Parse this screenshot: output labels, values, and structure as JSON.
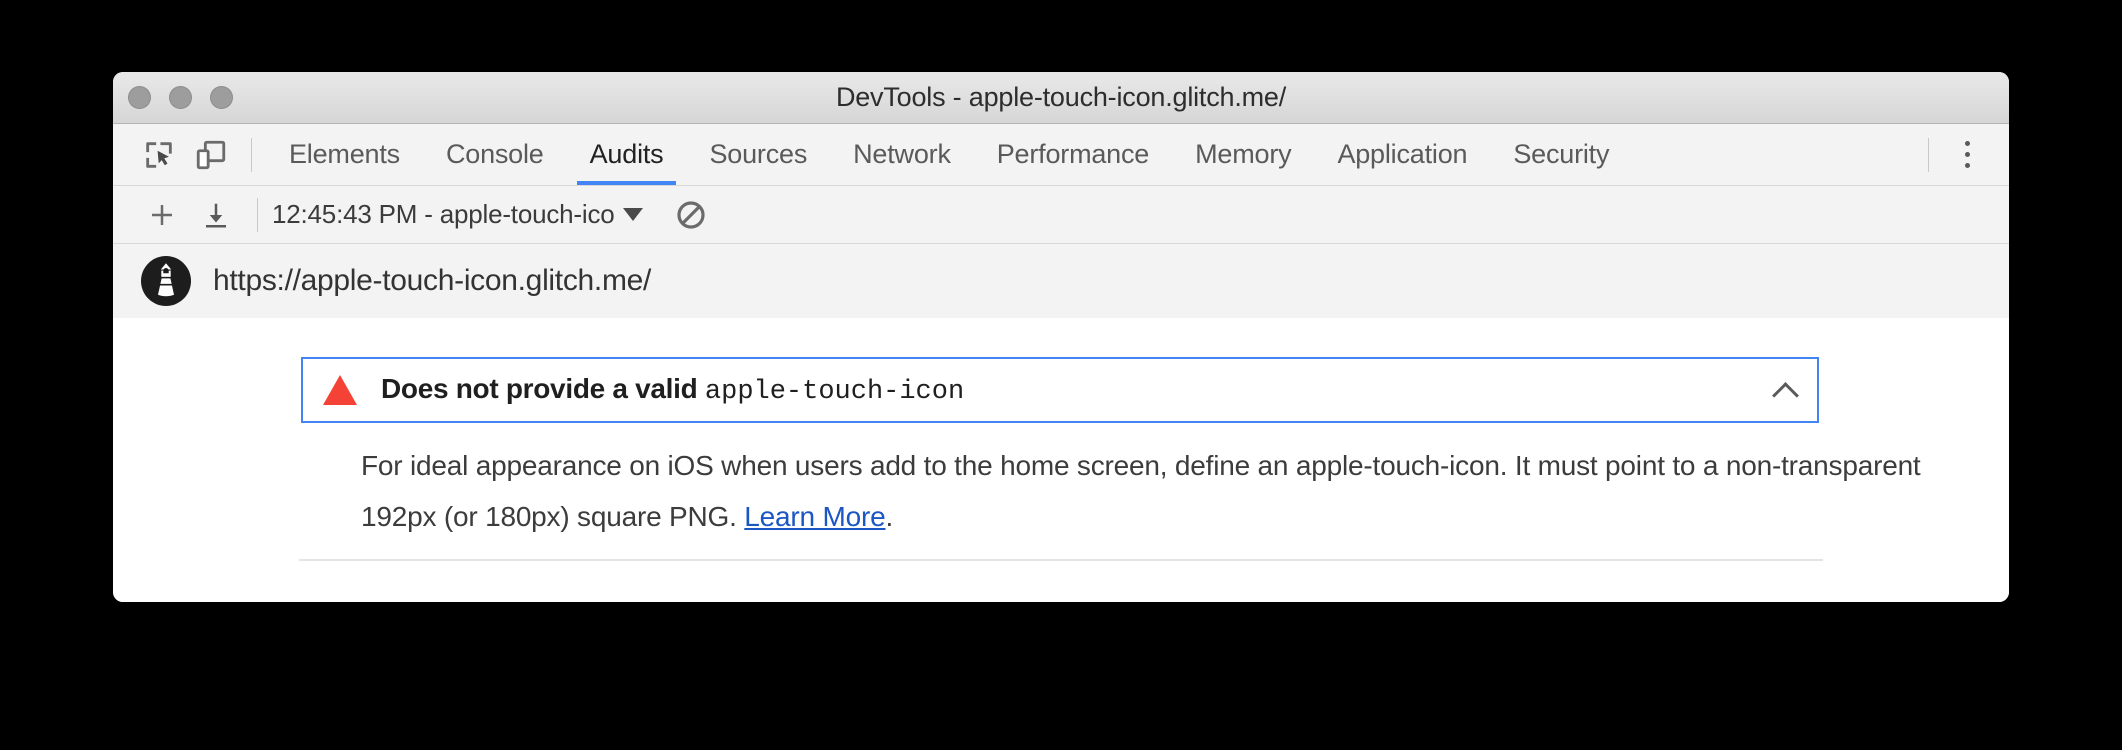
{
  "window": {
    "title": "DevTools - apple-touch-icon.glitch.me/",
    "traffic_lights": [
      "close",
      "minimize",
      "zoom"
    ]
  },
  "toolbar": {
    "inspect_icon": "inspect-element-icon",
    "device_icon": "device-toolbar-icon",
    "overflow_icon": "kebab-menu-icon"
  },
  "tabs": [
    {
      "label": "Elements",
      "active": false
    },
    {
      "label": "Console",
      "active": false
    },
    {
      "label": "Audits",
      "active": true
    },
    {
      "label": "Sources",
      "active": false
    },
    {
      "label": "Network",
      "active": false
    },
    {
      "label": "Performance",
      "active": false
    },
    {
      "label": "Memory",
      "active": false
    },
    {
      "label": "Application",
      "active": false
    },
    {
      "label": "Security",
      "active": false
    }
  ],
  "audits_toolbar": {
    "new_audit_label": "+",
    "new_audit_icon": "plus-icon",
    "download_icon": "download-icon",
    "report_selector_value": "12:45:43 PM - apple-touch-ico",
    "report_selector_caret": "chevron-down-icon",
    "clear_icon": "clear-all-icon"
  },
  "url_bar": {
    "favicon": "lighthouse-logo-icon",
    "url": "https://apple-touch-icon.glitch.me/"
  },
  "report": {
    "clipped_text": "",
    "audit": {
      "status_icon": "warning-triangle-icon",
      "title_text": "Does not provide a valid ",
      "title_code": "apple-touch-icon",
      "expanded": true,
      "toggle_icon": "chevron-up-icon",
      "description_before": "For ideal appearance on iOS when users add to the home screen, define an apple-touch-icon. It must point to a non-transparent 192px (or 180px) square PNG. ",
      "link_label": "Learn More",
      "description_after": "."
    }
  },
  "colors": {
    "accent_blue": "#4285f4",
    "link_blue": "#1a56c4",
    "warning_red": "#f44336",
    "toolbar_bg": "#f3f3f3",
    "titlebar_bg": "#d6d6d6"
  }
}
